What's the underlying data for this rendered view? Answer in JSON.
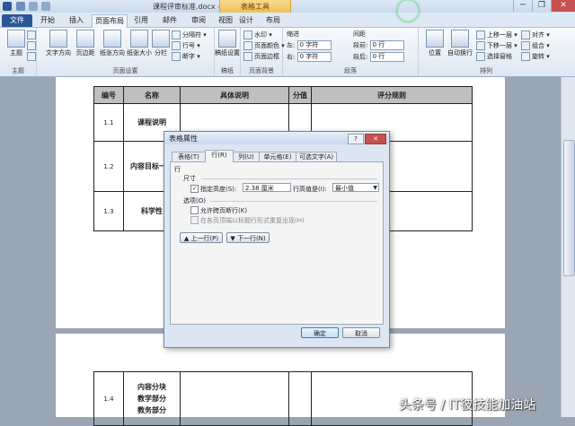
{
  "window": {
    "title": "课程评审标准.docx - Microsoft Word",
    "contextual_tab_header": "表格工具",
    "buttons": [
      "─",
      "❐",
      "✕"
    ]
  },
  "tabs": [
    {
      "label": "文件"
    },
    {
      "label": "开始"
    },
    {
      "label": "插入"
    },
    {
      "label": "页面布局"
    },
    {
      "label": "引用"
    },
    {
      "label": "邮件"
    },
    {
      "label": "审阅"
    },
    {
      "label": "视图"
    },
    {
      "label": "设计"
    },
    {
      "label": "布局"
    }
  ],
  "ribbon": {
    "themes": {
      "big": "主题",
      "group": "主题"
    },
    "page_setup": {
      "items": [
        "文字方向",
        "页边距",
        "纸张方向",
        "纸张大小",
        "分栏"
      ],
      "small": [
        "分隔符 ▾",
        "行号 ▾",
        "断字 ▾"
      ],
      "group": "页面设置"
    },
    "paper": {
      "big": "稿纸设置",
      "group": "稿纸"
    },
    "page_bg": {
      "items": [
        "水印 ▾",
        "页面颜色 ▾",
        "页面边框"
      ],
      "group": "页面背景"
    },
    "paragraph": {
      "indent": "缩进",
      "spacing": "间距",
      "left": "左:",
      "right": "右:",
      "before": "段前:",
      "after": "段后:",
      "left_val": "0 字符",
      "right_val": "0 字符",
      "before_val": "0 行",
      "after_val": "0 行",
      "group": "段落"
    },
    "arrange": {
      "items": [
        "位置",
        "自动换行"
      ],
      "small": [
        "上移一层 ▾",
        "下移一层 ▾",
        "选择窗格",
        "对齐 ▾",
        "组合 ▾",
        "旋转 ▾"
      ],
      "group": "排列"
    }
  },
  "document_table": {
    "headers": [
      "编号",
      "名称",
      "具体说明",
      "分值",
      "评分规则"
    ],
    "rows": [
      {
        "num": "1.1",
        "name": "课程说明"
      },
      {
        "num": "1.2",
        "name": "内容目标一致"
      },
      {
        "num": "1.3",
        "name": "科学性"
      }
    ],
    "page2_rows": [
      {
        "num": "1.4",
        "lines": [
          "内容分块",
          "教学部分",
          "教务部分"
        ]
      }
    ]
  },
  "dialog": {
    "title": "表格属性",
    "help": "?",
    "close": "✕",
    "tabs": [
      "表格(T)",
      "行(R)",
      "列(U)",
      "单元格(E)",
      "可选文字(A)"
    ],
    "active_tab": "行(R)",
    "section_row": "行",
    "size_label": "尺寸",
    "specify_height_label": "指定高度(S):",
    "specify_height_checked": true,
    "height_value": "2.38 厘米",
    "row_height_is_label": "行高值是(I):",
    "row_height_is_value": "最小值",
    "options_label": "选项(O)",
    "allow_break_label": "允许跨页断行(K)",
    "repeat_header_label": "在各页顶端以标题行形式重复出现(H)",
    "prev_row": "▲ 上一行(P)",
    "next_row": "▼ 下一行(N)",
    "ok": "确定",
    "cancel": "取消"
  },
  "watermark_text": "头条号 / IT彼技能加油站"
}
